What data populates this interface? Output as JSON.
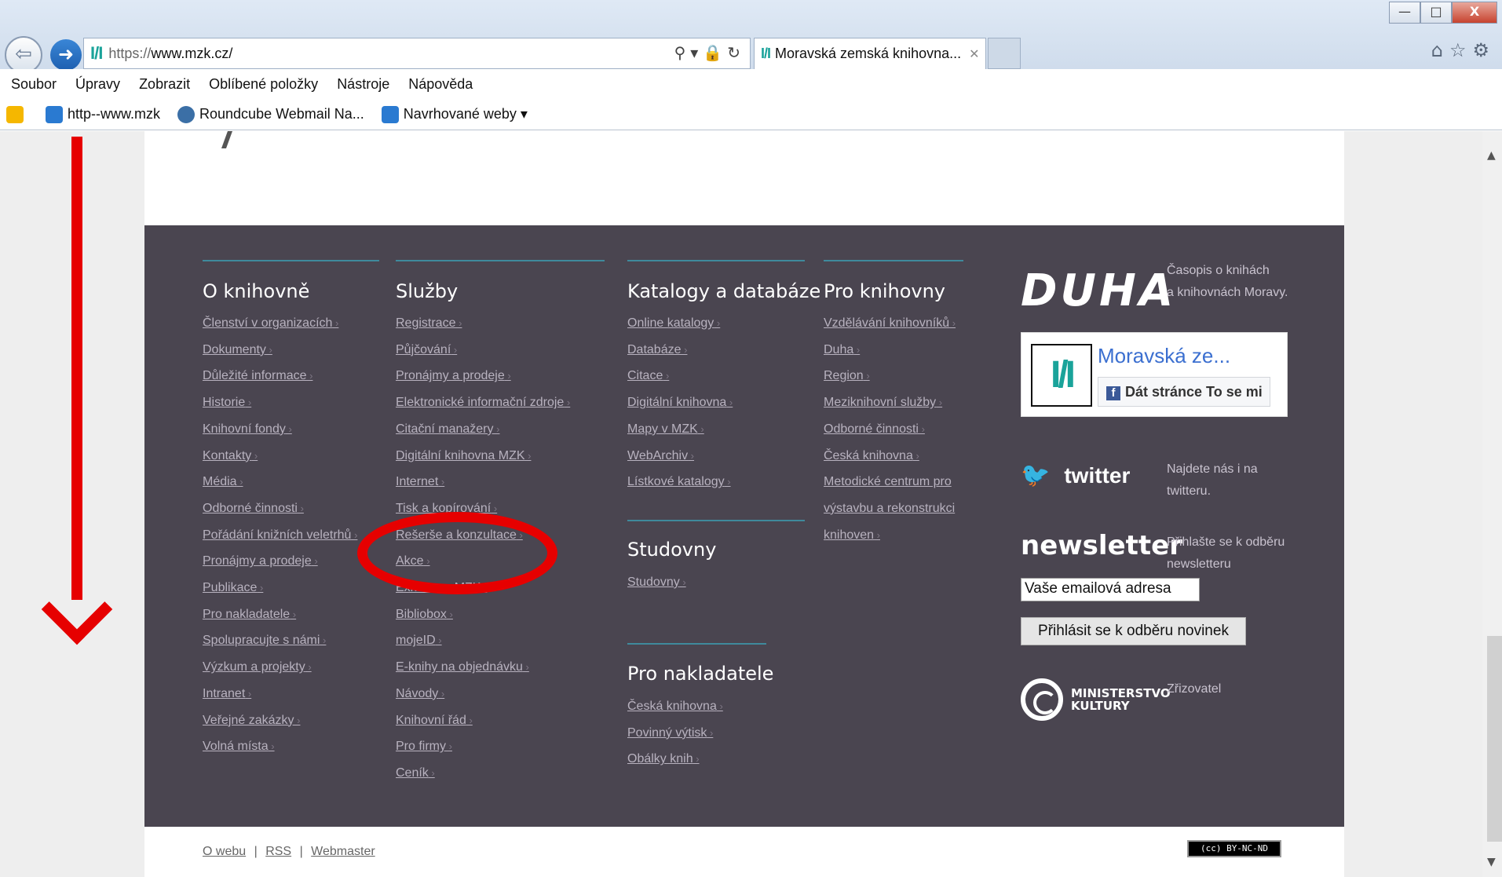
{
  "browser": {
    "url_scheme": "https://",
    "url_host": "www.mzk.cz/",
    "tab_title": "Moravská zemská knihovna...",
    "window_buttons": [
      "—",
      "□",
      "X"
    ],
    "right_icons": [
      "home-icon",
      "star-icon",
      "gear-icon"
    ]
  },
  "menubar": [
    "Soubor",
    "Úpravy",
    "Zobrazit",
    "Oblíbené položky",
    "Nástroje",
    "Nápověda"
  ],
  "favorites": [
    {
      "label": "http--www.mzk",
      "icon": "ie-icon"
    },
    {
      "label": "Roundcube Webmail Na...",
      "icon": "roundcube-icon"
    },
    {
      "label": "Navrhované weby ▾",
      "icon": "ie-icon"
    }
  ],
  "footer": {
    "o_knihovne": {
      "title": "O knihovně",
      "links": [
        "Členství v organizacích",
        "Dokumenty",
        "Důležité informace",
        "Historie",
        "Knihovní fondy",
        "Kontakty",
        "Média",
        "Odborné činnosti",
        "Pořádání knižních veletrhů",
        "Pronájmy a prodeje",
        "Publikace",
        "Pro nakladatele",
        "Spolupracujte s námi",
        "Výzkum a projekty",
        "Intranet",
        "Veřejné zakázky",
        "Volná místa"
      ]
    },
    "sluzby": {
      "title": "Služby",
      "links": [
        "Registrace",
        "Půjčování",
        "Pronájmy a prodeje",
        "Elektronické informační zdroje",
        "Citační manažery",
        "Digitální knihovna MZK",
        "Internet",
        "Tisk a kopírování",
        "Rešerše a konzultace",
        "Akce",
        "Exkurze v MZK",
        "Bibliobox",
        "mojeID",
        "E-knihy na objednávku",
        "Návody",
        "Knihovní řád",
        "Pro firmy",
        "Ceník"
      ]
    },
    "katalogy": {
      "title": "Katalogy a databáze",
      "links": [
        "Online katalogy",
        "Databáze",
        "Citace",
        "Digitální knihovna",
        "Mapy v MZK",
        "WebArchiv",
        "Lístkové katalogy"
      ]
    },
    "studovny": {
      "title": "Studovny",
      "links": [
        "Studovny"
      ]
    },
    "pro_nakladatele": {
      "title": "Pro nakladatele",
      "links": [
        "Česká knihovna",
        "Povinný výtisk",
        "Obálky knih"
      ]
    },
    "pro_knihovny": {
      "title": "Pro knihovny",
      "links": [
        "Vzdělávání knihovníků",
        "Duha",
        "Region",
        "Meziknihovní služby",
        "Odborné činnosti",
        "Česká knihovna",
        "Metodické centrum pro",
        "výstavbu a rekonstrukci",
        "knihoven"
      ]
    },
    "duha": {
      "logo": "DUHA",
      "line1": "Časopis o knihách",
      "line2": "a knihovnách Moravy."
    },
    "facebook": {
      "name": "Moravská ze...",
      "like": "Dát stránce To se mi"
    },
    "twitter": {
      "label": "twitter",
      "line1": "Najdete nás i na",
      "line2": "twitteru."
    },
    "newsletter": {
      "label": "newsletter",
      "line1": "Přihlašte se k odběru",
      "line2": "newsletteru",
      "input_value": "Vaše emailová adresa",
      "button": "Přihlásit se k odběru novinek"
    },
    "ministerstvo": {
      "line1": "MINISTERSTVO",
      "line2": "KULTURY",
      "caption": "Zřizovatel"
    }
  },
  "bottom": {
    "o_webu": "O webu",
    "rss": "RSS",
    "webmaster": "Webmaster",
    "sep": "|",
    "license": "(cc) BY-NC-ND"
  },
  "colors": {
    "footer_bg": "#4a4550",
    "accent_rule": "#3f8a9c",
    "annotation_red": "#e60000"
  }
}
